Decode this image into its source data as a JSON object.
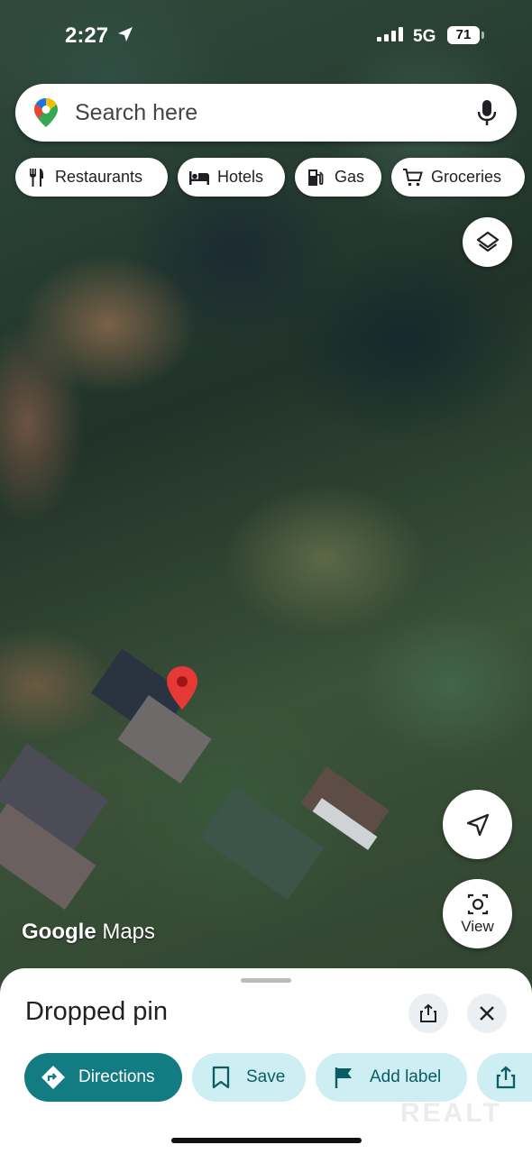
{
  "status_bar": {
    "time": "2:27",
    "network": "5G",
    "battery": "71"
  },
  "search": {
    "placeholder": "Search here"
  },
  "chips": [
    {
      "label": "Restaurants",
      "icon": "restaurant-icon"
    },
    {
      "label": "Hotels",
      "icon": "hotel-icon"
    },
    {
      "label": "Gas",
      "icon": "gas-icon"
    },
    {
      "label": "Groceries",
      "icon": "cart-icon"
    }
  ],
  "map": {
    "attribution_google": "Google",
    "attribution_maps": "Maps",
    "watermark": "REALT"
  },
  "view_button": {
    "label": "View"
  },
  "sheet": {
    "title": "Dropped pin",
    "actions": [
      {
        "label": "Directions",
        "icon": "directions-icon"
      },
      {
        "label": "Save",
        "icon": "bookmark-icon"
      },
      {
        "label": "Add label",
        "icon": "flag-icon"
      }
    ]
  },
  "colors": {
    "primary": "#137b82",
    "tonal": "#cdeef2",
    "pin": "#e53935"
  }
}
